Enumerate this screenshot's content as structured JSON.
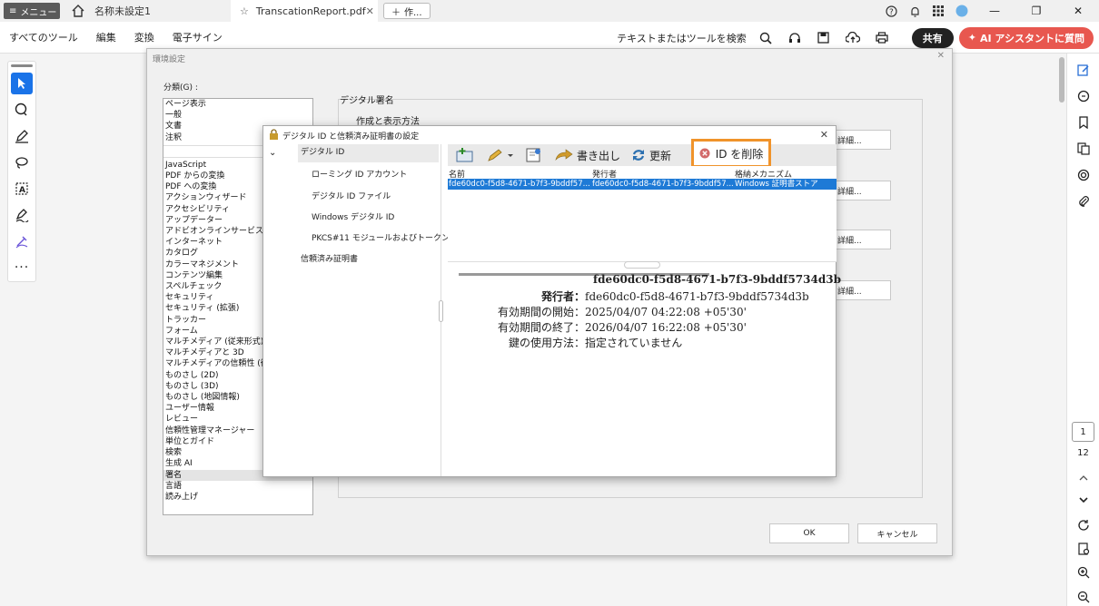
{
  "tabbar": {
    "menu_label": "メニュー",
    "tab1": "名称未設定1",
    "tab2": "TranscationReport.pdf",
    "new_tab": "作..."
  },
  "toolbar": {
    "items": [
      "すべてのツール",
      "編集",
      "変換",
      "電子サイン"
    ],
    "search_text": "テキストまたはツールを検索",
    "share": "共有",
    "ai": "AI アシスタントに質問"
  },
  "rightbar": {
    "page_current": "1",
    "page_total": "12"
  },
  "preferences": {
    "title": "環境設定",
    "category_label": "分類(G) :",
    "categories_top": [
      "ページ表示",
      "一般",
      "文書",
      "注釈"
    ],
    "categories": [
      "JavaScript",
      "PDF からの変換",
      "PDF への変換",
      "アクションウィザード",
      "アクセシビリティ",
      "アップデーター",
      "アドビオンラインサービス",
      "インターネット",
      "カタログ",
      "カラーマネジメント",
      "コンテンツ編集",
      "スペルチェック",
      "セキュリティ",
      "セキュリティ (拡張)",
      "トラッカー",
      "フォーム",
      "マルチメディア (従来形式)",
      "マルチメディアと 3D",
      "マルチメディアの信頼性 (従来",
      "ものさし (2D)",
      "ものさし (3D)",
      "ものさし (地図情報)",
      "ユーザー情報",
      "レビュー",
      "信頼性管理マネージャー",
      "単位とガイド",
      "検索",
      "生成 AI",
      "署名",
      "言語",
      "読み上げ"
    ],
    "selected_category": "署名",
    "signature_label": "デジタル署名",
    "section_label": "作成と表示方法",
    "detail_label": "詳細...",
    "ok": "OK",
    "cancel": "キャンセル"
  },
  "digital_id_dialog": {
    "title": "デジタル ID と信頼済み証明書の設定",
    "tree": {
      "digital_id": "デジタル ID",
      "roaming": "ローミング ID アカウント",
      "files": "デジタル ID ファイル",
      "windows": "Windows デジタル ID",
      "pkcs": "PKCS#11 モジュールおよびトークン",
      "trusted": "信頼済み証明書"
    },
    "toolbar": {
      "export": "書き出し",
      "refresh": "更新",
      "remove_id": "ID を削除"
    },
    "columns": [
      "名前",
      "発行者",
      "格納メカニズム"
    ],
    "row": {
      "name": "fde60dc0-f5d8-4671-b7f3-9bddf57...",
      "issuer": "fde60dc0-f5d8-4671-b7f3-9bddf57...",
      "storage": "Windows 証明書ストア"
    },
    "detail": {
      "title": "fde60dc0-f5d8-4671-b7f3-9bddf5734d3b",
      "issuer_label": "発行者：",
      "issuer_value": "fde60dc0-f5d8-4671-b7f3-9bddf5734d3b",
      "valid_from_label": "有効期間の開始：",
      "valid_from_value": "2025/04/07 04:22:08 +05'30'",
      "valid_to_label": "有効期間の終了：",
      "valid_to_value": "2026/04/07 16:22:08 +05'30'",
      "key_usage_label": "鍵の使用方法：",
      "key_usage_value": "指定されていません"
    }
  },
  "colors": {
    "selection": "#1e7ad6",
    "highlight_border": "#f0932b",
    "ai_button": "#e8574f"
  }
}
